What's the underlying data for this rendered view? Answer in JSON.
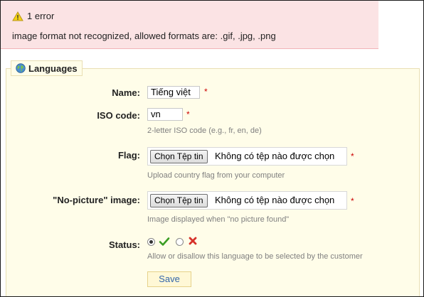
{
  "error": {
    "title": "1 error",
    "message": "image format not recognized, allowed formats are: .gif, .jpg, .png"
  },
  "fieldset": {
    "legend": "Languages"
  },
  "form": {
    "name": {
      "label": "Name:",
      "value": "Tiếng việt",
      "required": "*"
    },
    "iso": {
      "label": "ISO code:",
      "value": "vn",
      "required": "*",
      "hint": "2-letter ISO code (e.g., fr, en, de)"
    },
    "flag": {
      "label": "Flag:",
      "button": "Chọn Tệp tin",
      "no_file": "Không có tệp nào được chọn",
      "required": "*",
      "hint": "Upload country flag from your computer"
    },
    "no_picture": {
      "label": "\"No-picture\" image:",
      "button": "Chọn Tệp tin",
      "no_file": "Không có tệp nào được chọn",
      "required": "*",
      "hint": "Image displayed when \"no picture found\""
    },
    "status": {
      "label": "Status:",
      "hint": "Allow or disallow this language to be selected by the customer",
      "selected": "enabled"
    },
    "save_label": "Save"
  },
  "colors": {
    "error_bg": "#fbe3e4",
    "fieldset_bg": "#fffde9",
    "required": "#cc0000",
    "enabled_icon": "#3a9d23",
    "disabled_icon": "#d6322a"
  }
}
